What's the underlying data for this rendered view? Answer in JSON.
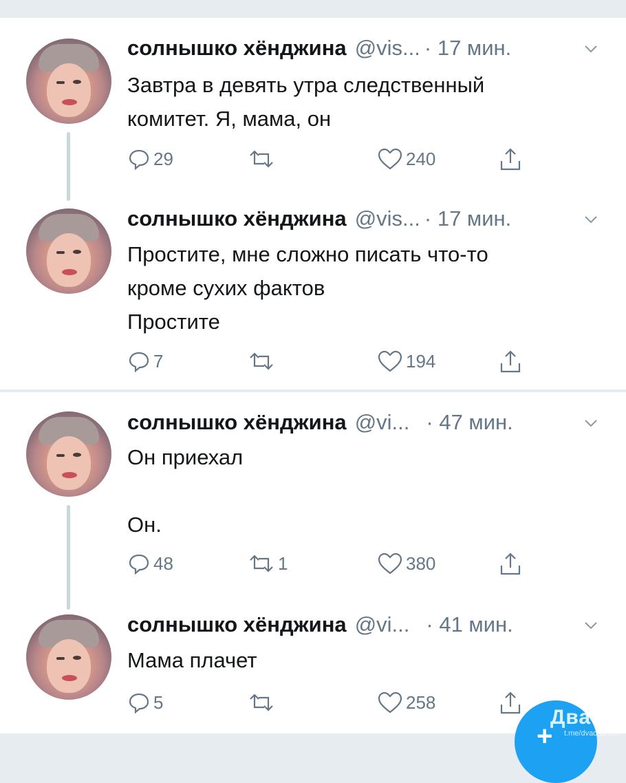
{
  "tweets": [
    {
      "name": "солнышко хёнджина",
      "handle": "@vis...",
      "time": "· 17 мин.",
      "text": "Завтра в девять утра следственный\nкомитет. Я, мама, он",
      "reply_count": "29",
      "retweet_count": "",
      "like_count": "240"
    },
    {
      "name": "солнышко хёнджина",
      "handle": "@vis...",
      "time": "· 17 мин.",
      "text": "Простите, мне сложно писать что-то\nкроме сухих фактов\nПростите",
      "reply_count": "7",
      "retweet_count": "",
      "like_count": "194"
    },
    {
      "name": "солнышко хёнджина",
      "handle": "@vi...",
      "time": "· 47 мин.",
      "text": "Он приехал\n\nОн.",
      "reply_count": "48",
      "retweet_count": "1",
      "like_count": "380"
    },
    {
      "name": "солнышко хёнджина",
      "handle": "@vi...",
      "time": "· 41 мин.",
      "text": "Мама плачет",
      "reply_count": "5",
      "retweet_count": "",
      "like_count": "258"
    }
  ],
  "icons": {
    "reply": "reply-icon",
    "retweet": "retweet-icon",
    "like": "heart-icon",
    "share": "share-icon",
    "menu": "chevron-down-icon"
  },
  "watermark": {
    "logo": "Двач",
    "url": "t.me/dvachannel"
  },
  "colors": {
    "background": "#e6ecf0",
    "card": "#ffffff",
    "secondary_text": "#657786",
    "accent": "#1da1f2"
  }
}
